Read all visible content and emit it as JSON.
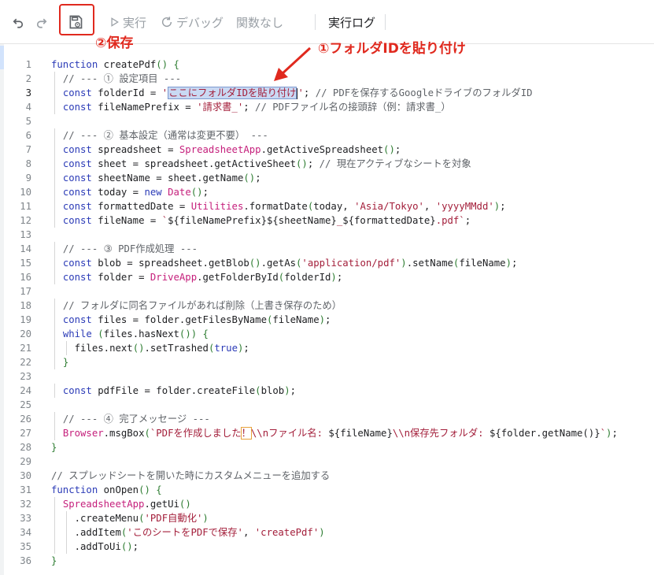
{
  "toolbar": {
    "run_label": "実行",
    "debug_label": "デバッグ",
    "function_label": "関数なし",
    "log_label": "実行ログ"
  },
  "annotations": {
    "save": "②保存",
    "paste": "①フォルダIDを貼り付け"
  },
  "colors": {
    "annotation": "#e0291e",
    "selection": "#c9d9f3"
  },
  "editor": {
    "active_line": 3,
    "lines": [
      "function createPdf() {",
      "  // --- ① 設定項目 ---",
      "  const folderId = 'ここにフォルダIDを貼り付け'; // PDFを保存するGoogleドライブのフォルダID",
      "  const fileNamePrefix = '請求書_'; // PDFファイル名の接頭辞（例：請求書_）",
      "",
      "  // --- ② 基本設定（通常は変更不要） ---",
      "  const spreadsheet = SpreadsheetApp.getActiveSpreadsheet();",
      "  const sheet = spreadsheet.getActiveSheet(); // 現在アクティブなシートを対象",
      "  const sheetName = sheet.getName();",
      "  const today = new Date();",
      "  const formattedDate = Utilities.formatDate(today, 'Asia/Tokyo', 'yyyyMMdd');",
      "  const fileName = `${fileNamePrefix}${sheetName}_${formattedDate}.pdf`;",
      "",
      "  // --- ③ PDF作成処理 ---",
      "  const blob = spreadsheet.getBlob().getAs('application/pdf').setName(fileName);",
      "  const folder = DriveApp.getFolderById(folderId);",
      "",
      "  // フォルダに同名ファイルがあれば削除（上書き保存のため）",
      "  const files = folder.getFilesByName(fileName);",
      "  while (files.hasNext()) {",
      "    files.next().setTrashed(true);",
      "  }",
      "",
      "  const pdfFile = folder.createFile(blob);",
      "",
      "  // --- ④ 完了メッセージ ---",
      "  Browser.msgBox(`PDFを作成しました！\\\\nファイル名: ${fileName}\\\\n保存先フォルダ: ${folder.getName()}`);",
      "}",
      "",
      "// スプレッドシートを開いた時にカスタムメニューを追加する",
      "function onOpen() {",
      "  SpreadsheetApp.getUi()",
      "    .createMenu('PDF自動化')",
      "    .addItem('このシートをPDFで保存', 'createPdf')",
      "    .addToUi();",
      "}"
    ]
  }
}
